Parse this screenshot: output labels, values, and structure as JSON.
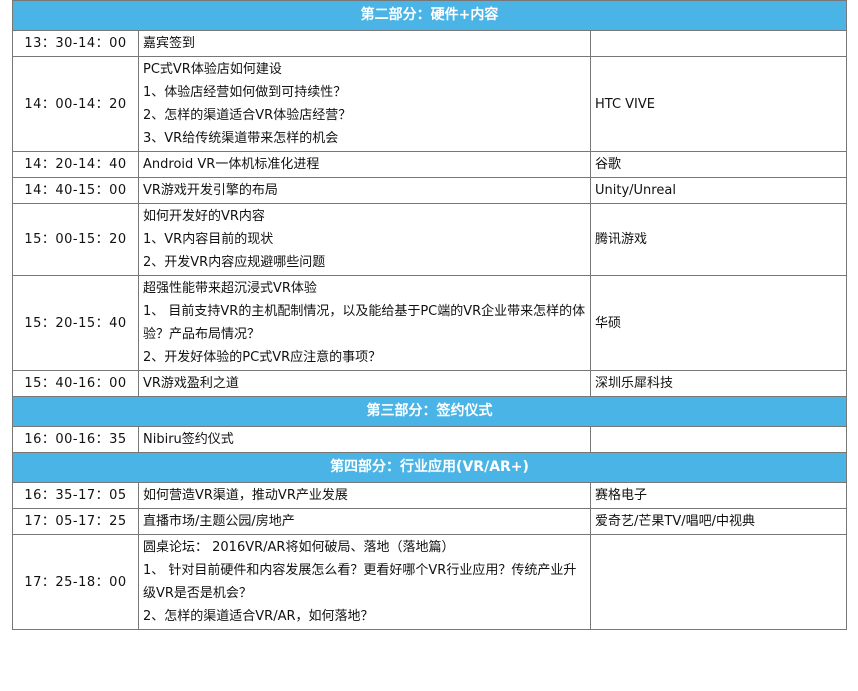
{
  "sections": [
    {
      "title": "第二部分：硬件+内容",
      "rows": [
        {
          "time": "13：30-14：00",
          "lines": [
            "嘉宾签到"
          ],
          "speaker": ""
        },
        {
          "time": "14：00-14：20",
          "lines": [
            "PC式VR体验店如何建设",
            "1、体验店经营如何做到可持续性？",
            "2、怎样的渠道适合VR体验店经营？",
            "3、VR给传统渠道带来怎样的机会"
          ],
          "speaker": "HTC VIVE"
        },
        {
          "time": "14：20-14：40",
          "lines": [
            "Android VR一体机标准化进程"
          ],
          "speaker": "谷歌"
        },
        {
          "time": "14：40-15：00",
          "lines": [
            "VR游戏开发引擎的布局"
          ],
          "speaker": "Unity/Unreal"
        },
        {
          "time": "15：00-15：20",
          "lines": [
            "如何开发好的VR内容",
            "1、VR内容目前的现状",
            "2、开发VR内容应规避哪些问题"
          ],
          "speaker": "腾讯游戏"
        },
        {
          "time": "15：20-15：40",
          "lines": [
            "超强性能带来超沉浸式VR体验",
            "1、 目前支持VR的主机配制情况，以及能给基于PC端的VR企业带来怎样的体验？产品布局情况？",
            "2、开发好体验的PC式VR应注意的事项？"
          ],
          "speaker": "华硕"
        },
        {
          "time": "15：40-16：00",
          "lines": [
            "VR游戏盈利之道"
          ],
          "speaker": "深圳乐犀科技"
        }
      ]
    },
    {
      "title": "第三部分：签约仪式",
      "rows": [
        {
          "time": "16：00-16：35",
          "lines": [
            "Nibiru签约仪式"
          ],
          "speaker": ""
        }
      ]
    },
    {
      "title": "第四部分：行业应用(VR/AR+)",
      "rows": [
        {
          "time": "16：35-17：05",
          "lines": [
            "如何营造VR渠道，推动VR产业发展"
          ],
          "speaker": "赛格电子"
        },
        {
          "time": "17：05-17：25",
          "lines": [
            "直播市场/主题公园/房地产"
          ],
          "speaker": "爱奇艺/芒果TV/唱吧/中视典"
        },
        {
          "time": "17：25-18：00",
          "lines": [
            "圆桌论坛： 2016VR/AR将如何破局、落地（落地篇）",
            "1、 针对目前硬件和内容发展怎么看？更看好哪个VR行业应用？传统产业升级VR是否是机会？",
            "2、怎样的渠道适合VR/AR，如何落地？"
          ],
          "speaker": ""
        }
      ]
    }
  ],
  "colors": {
    "section_header_bg": "#4ab4e6",
    "border": "#777777"
  }
}
